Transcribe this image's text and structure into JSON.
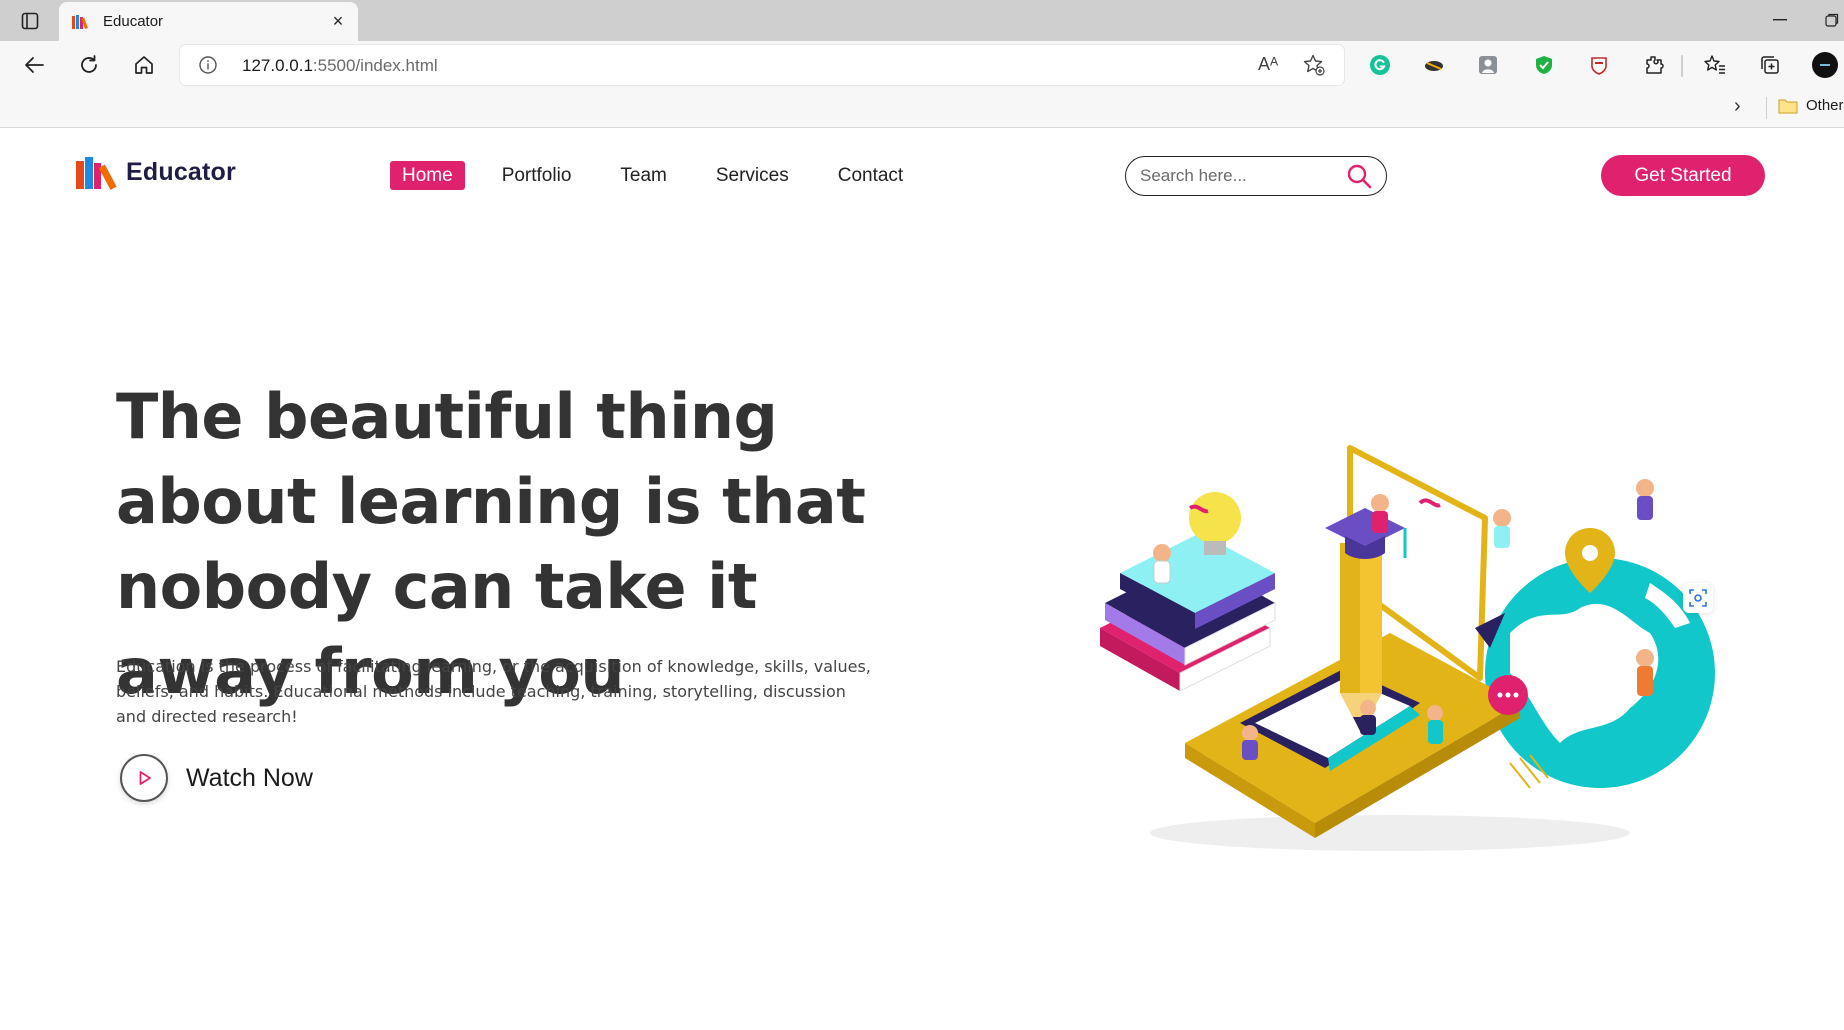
{
  "browser": {
    "tab_title": "Educator",
    "close_glyph": "×",
    "url_host": "127.0.0.1",
    "url_rest": ":5500/index.html",
    "read_aloud_glyph": "Aᴬ",
    "bookmarks_chevron": "›",
    "bookmarks_folder": "Other"
  },
  "site": {
    "brand": "Educator",
    "nav": [
      "Home",
      "Portfolio",
      "Team",
      "Services",
      "Contact"
    ],
    "active_nav": "Home",
    "search_placeholder": "Search here...",
    "cta_label": "Get Started",
    "headline": "The beautiful thing about learning is that nobody can take it away from you",
    "description": "Education is the process of facilitating learning, or the acquisition of knowledge, skills, values, beliefs, and habits. Educational methods include teaching, training, storytelling, discussion and directed research!",
    "watch_label": "Watch Now"
  },
  "colors": {
    "accent": "#e0226e",
    "brand_text": "#1f1d45",
    "illustration_yellow": "#e2b418",
    "illustration_teal": "#12c7c9"
  },
  "icons": [
    "tab-actions-icon",
    "back-arrow-icon",
    "refresh-icon",
    "home-icon",
    "info-icon",
    "read-aloud-icon",
    "add-favorite-icon",
    "grammarly-icon",
    "extension-icon",
    "favorites-icon",
    "collections-icon",
    "search-icon",
    "play-icon",
    "visual-search-icon"
  ]
}
